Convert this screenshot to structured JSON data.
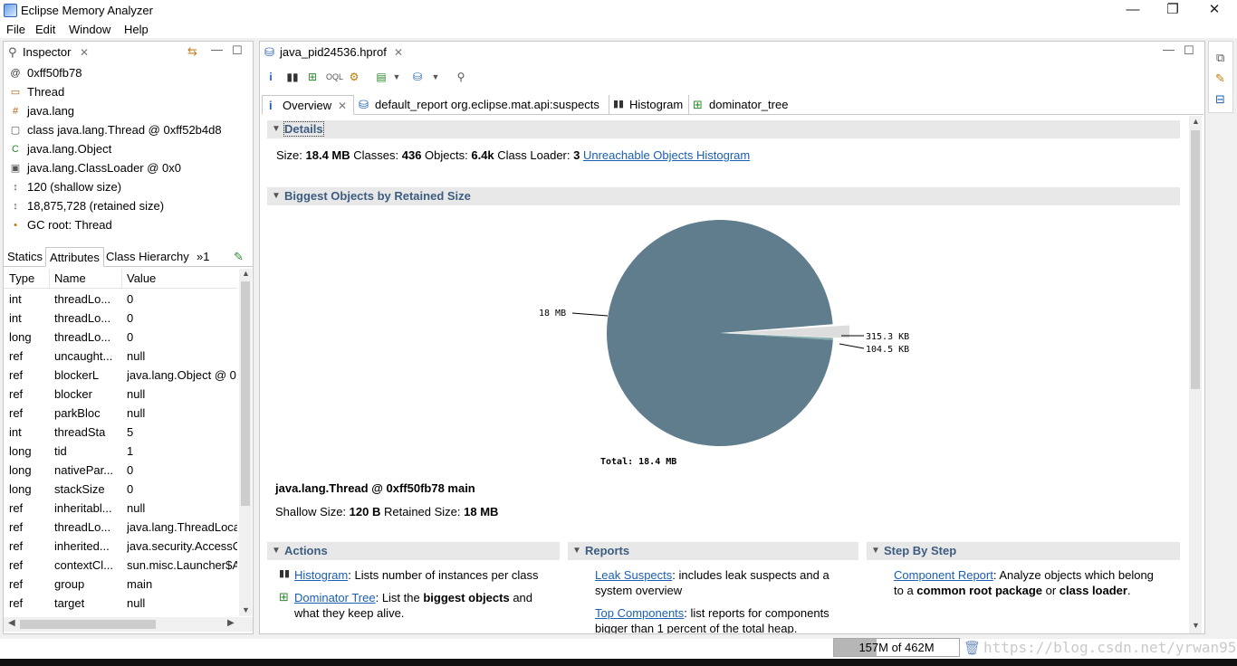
{
  "window": {
    "title": "Eclipse Memory Analyzer",
    "controls": {
      "minimize": "—",
      "restore": "❐",
      "close": "✕"
    }
  },
  "menu": [
    "File",
    "Edit",
    "Window",
    "Help"
  ],
  "inspector": {
    "tab_label": "Inspector",
    "rows": [
      {
        "icon": "at-icon",
        "glyph": "@",
        "text": "0xff50fb78"
      },
      {
        "icon": "thread-icon",
        "glyph": "▭",
        "text": "Thread"
      },
      {
        "icon": "package-icon",
        "glyph": "#",
        "text": "java.lang"
      },
      {
        "icon": "class-icon",
        "glyph": "▢",
        "text": "class java.lang.Thread @ 0xff52b4d8"
      },
      {
        "icon": "superclass-icon",
        "glyph": "C",
        "text": "java.lang.Object"
      },
      {
        "icon": "classloader-icon",
        "glyph": "▣",
        "text": "java.lang.ClassLoader @ 0x0"
      },
      {
        "icon": "shallow-size-icon",
        "glyph": "↕",
        "text": "120 (shallow size)"
      },
      {
        "icon": "retained-size-icon",
        "glyph": "↕",
        "text": "18,875,728 (retained size)"
      },
      {
        "icon": "gc-root-icon",
        "glyph": "•",
        "text": "GC root: Thread"
      }
    ],
    "sub_tabs": [
      "Statics",
      "Attributes",
      "Class Hierarchy",
      "»1"
    ],
    "table": {
      "columns": [
        "Type",
        "Name",
        "Value"
      ],
      "rows": [
        [
          "int",
          "threadLo...",
          "0"
        ],
        [
          "int",
          "threadLo...",
          "0"
        ],
        [
          "long",
          "threadLo...",
          "0"
        ],
        [
          "ref",
          "uncaught...",
          "null"
        ],
        [
          "ref",
          "blockerL",
          "java.lang.Object @ 0:"
        ],
        [
          "ref",
          "blocker",
          "null"
        ],
        [
          "ref",
          "parkBloc",
          "null"
        ],
        [
          "int",
          "threadSta",
          "5"
        ],
        [
          "long",
          "tid",
          "1"
        ],
        [
          "long",
          "nativePar...",
          "0"
        ],
        [
          "long",
          "stackSize",
          "0"
        ],
        [
          "ref",
          "inheritabl...",
          "null"
        ],
        [
          "ref",
          "threadLo...",
          "java.lang.ThreadLoca"
        ],
        [
          "ref",
          "inherited...",
          "java.security.AccessC"
        ],
        [
          "ref",
          "contextCl...",
          "sun.misc.Launcher$A|"
        ],
        [
          "ref",
          "group",
          "main"
        ],
        [
          "ref",
          "target",
          "null"
        ]
      ]
    }
  },
  "editor": {
    "tab_label": "java_pid24536.hprof",
    "inner_tabs": [
      {
        "label": "Overview",
        "icon": "info-icon"
      },
      {
        "label": "default_report  org.eclipse.mat.api:suspects",
        "icon": "report-icon"
      },
      {
        "label": "Histogram",
        "icon": "histogram-icon"
      },
      {
        "label": "dominator_tree",
        "icon": "dominator-tree-icon"
      }
    ],
    "details": {
      "title": "Details",
      "size_label": "Size: ",
      "size_value": "18.4 MB",
      "classes_label": " Classes: ",
      "classes_value": "436",
      "objects_label": " Objects: ",
      "objects_value": "6.4k",
      "loader_label": " Class Loader: ",
      "loader_value": "3",
      "link": "Unreachable Objects Histogram"
    },
    "biggest": {
      "title": "Biggest Objects by Retained Size",
      "selected_object": "java.lang.Thread @ 0xff50fb78 main",
      "shallow_label": "Shallow Size: ",
      "shallow_value": "120 B",
      "retained_label": " Retained Size: ",
      "retained_value": "18 MB"
    },
    "actions": {
      "title": "Actions",
      "items": [
        {
          "link": "Histogram",
          "text": ": Lists number of instances per class"
        },
        {
          "link": "Dominator Tree",
          "text_a": ": List the ",
          "bold": "biggest objects",
          "text_b": " and",
          "text_c": "what they keep alive."
        }
      ]
    },
    "reports": {
      "title": "Reports",
      "items": [
        {
          "link": "Leak Suspects",
          "text": ": includes leak suspects and a",
          "text2": "system overview"
        },
        {
          "link": "Top Components",
          "text": ": list reports for components",
          "text2": "bigger than 1 percent of the total heap."
        }
      ]
    },
    "step": {
      "title": "Step By Step",
      "link": "Component Report",
      "text": ": Analyze objects which belong",
      "text2_a": "to a ",
      "bold1": "common root package",
      "text2_b": " or ",
      "bold2": "class loader",
      "text2_c": "."
    }
  },
  "chart_data": {
    "type": "pie",
    "slices": [
      {
        "label": "18 MB",
        "value": 18432,
        "color": "#5f7d8c"
      },
      {
        "label": "315.3 KB",
        "value": 315.3,
        "color": "#dddddd"
      },
      {
        "label": "104.5 KB",
        "value": 104.5,
        "color": "#8ab0b2"
      }
    ],
    "total_label": "Total: 18.4 MB"
  },
  "status": {
    "heap": "157M of 462M",
    "heap_used_fraction": 0.34,
    "watermark": "https://blog.csdn.net/yrwan95"
  }
}
